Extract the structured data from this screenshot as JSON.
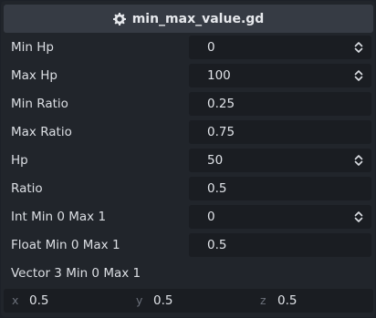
{
  "header": {
    "title": "min_max_value.gd",
    "icon": "gear-icon"
  },
  "rows": [
    {
      "label": "Min Hp",
      "value": "0",
      "spinner": true
    },
    {
      "label": "Max Hp",
      "value": "100",
      "spinner": true
    },
    {
      "label": "Min Ratio",
      "value": "0.25",
      "spinner": false
    },
    {
      "label": "Max Ratio",
      "value": "0.75",
      "spinner": false
    },
    {
      "label": "Hp",
      "value": "50",
      "spinner": true
    },
    {
      "label": "Ratio",
      "value": "0.5",
      "spinner": false
    },
    {
      "label": "Int Min 0 Max 1",
      "value": "0",
      "spinner": true
    },
    {
      "label": "Float Min 0 Max 1",
      "value": "0.5",
      "spinner": false
    }
  ],
  "vector": {
    "label": "Vector 3 Min 0 Max 1",
    "x_label": "x",
    "x_value": "0.5",
    "y_label": "y",
    "y_value": "0.5",
    "z_label": "z",
    "z_value": "0.5"
  }
}
